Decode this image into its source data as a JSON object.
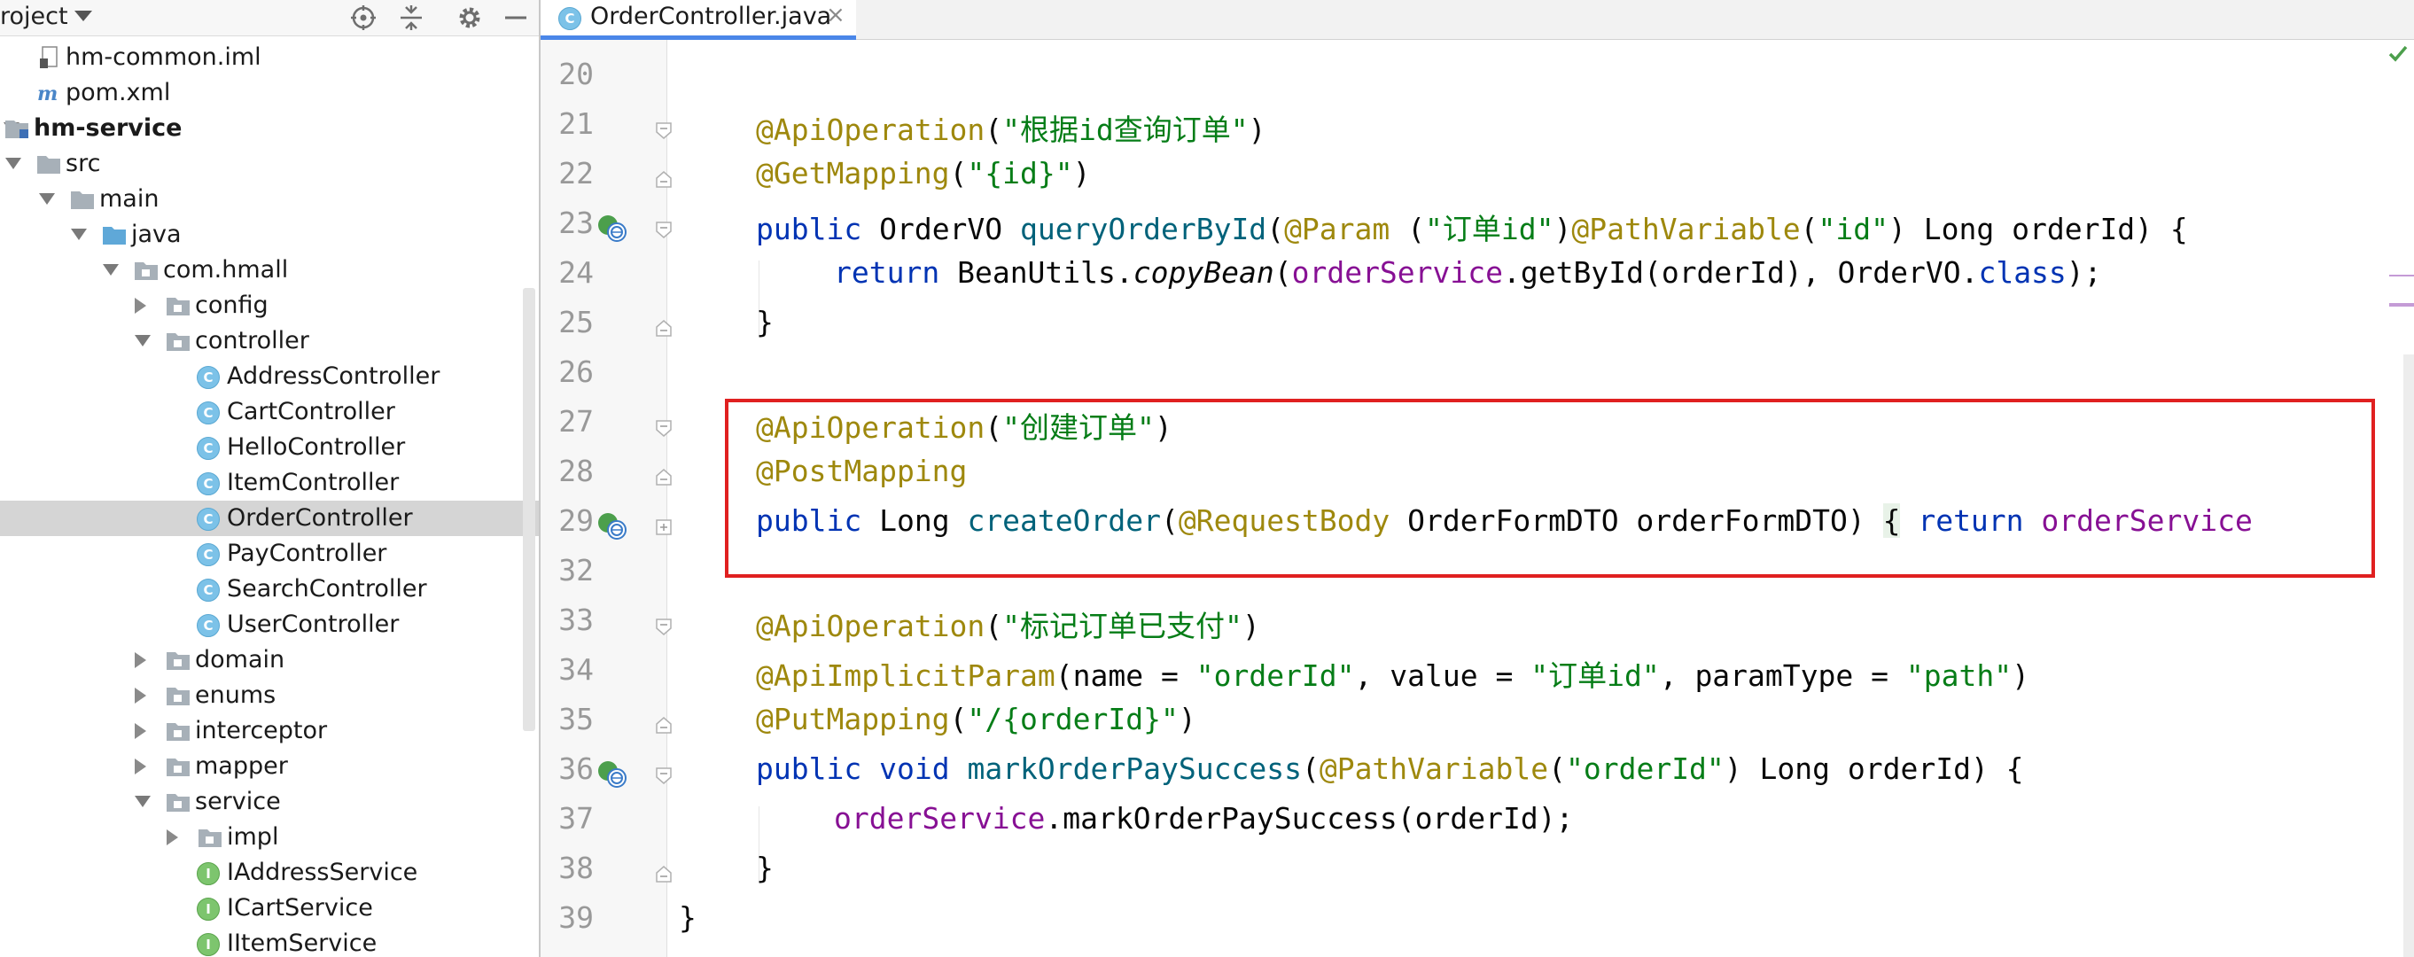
{
  "project_panel": {
    "title": "roject",
    "tree": [
      {
        "label": "hm-common.iml",
        "icon": "iml-file-icon",
        "depth": 1
      },
      {
        "label": "pom.xml",
        "icon": "maven-file-icon",
        "depth": 1
      },
      {
        "label": "hm-service",
        "icon": "module-folder-icon",
        "depth": 0,
        "bold": true
      },
      {
        "label": "src",
        "icon": "folder-icon",
        "depth": 1
      },
      {
        "label": "main",
        "icon": "folder-icon",
        "depth": 2
      },
      {
        "label": "java",
        "icon": "source-folder-icon",
        "depth": 3
      },
      {
        "label": "com.hmall",
        "icon": "package-icon",
        "depth": 4
      },
      {
        "label": "config",
        "icon": "package-icon",
        "depth": 5
      },
      {
        "label": "controller",
        "icon": "package-icon",
        "depth": 5
      },
      {
        "label": "AddressController",
        "icon": "class-icon",
        "depth": 6
      },
      {
        "label": "CartController",
        "icon": "class-icon",
        "depth": 6
      },
      {
        "label": "HelloController",
        "icon": "class-icon",
        "depth": 6
      },
      {
        "label": "ItemController",
        "icon": "class-icon",
        "depth": 6
      },
      {
        "label": "OrderController",
        "icon": "class-icon",
        "depth": 6
      },
      {
        "label": "PayController",
        "icon": "class-icon",
        "depth": 6
      },
      {
        "label": "SearchController",
        "icon": "class-icon",
        "depth": 6
      },
      {
        "label": "UserController",
        "icon": "class-icon",
        "depth": 6
      },
      {
        "label": "domain",
        "icon": "package-icon",
        "depth": 5
      },
      {
        "label": "enums",
        "icon": "package-icon",
        "depth": 5
      },
      {
        "label": "interceptor",
        "icon": "package-icon",
        "depth": 5
      },
      {
        "label": "mapper",
        "icon": "package-icon",
        "depth": 5
      },
      {
        "label": "service",
        "icon": "package-icon",
        "depth": 5
      },
      {
        "label": "impl",
        "icon": "package-icon",
        "depth": 6
      },
      {
        "label": "IAddressService",
        "icon": "interface-icon",
        "depth": 6
      },
      {
        "label": "ICartService",
        "icon": "interface-icon",
        "depth": 6
      },
      {
        "label": "IItemService",
        "icon": "interface-icon",
        "depth": 6
      }
    ],
    "class_badge": "C",
    "interface_badge": "I"
  },
  "editor": {
    "tab_label": "OrderController.java",
    "tab_close": "×",
    "line_numbers": [
      "20",
      "21",
      "22",
      "23",
      "24",
      "25",
      "26",
      "27",
      "28",
      "29",
      "32",
      "33",
      "34",
      "35",
      "36",
      "37",
      "38",
      "39"
    ],
    "lines": {
      "l21": {
        "ann": "@ApiOperation",
        "p1": "(",
        "s1": "\"根据id查询订单\"",
        "p2": ")"
      },
      "l22": {
        "ann": "@GetMapping",
        "p1": "(",
        "s1": "\"{id}\"",
        "p2": ")"
      },
      "l23": {
        "kw": "public",
        "type": " OrderVO ",
        "fn": "queryOrderById",
        "p1": "(",
        "ann1": "@Param",
        "sp": " (",
        "s1": "\"订单id\"",
        "p2": ")",
        "ann2": "@PathVariable",
        "p3": "(",
        "s2": "\"id\"",
        "p4": ") Long orderId) {"
      },
      "l24": {
        "kw": "return",
        "t1": " BeanUtils.",
        "it": "copyBean",
        "p1": "(",
        "fld": "orderService",
        "t2": ".getById(orderId), OrderVO.",
        "kw2": "class",
        "p2": ");"
      },
      "l25": {
        "t": "}"
      },
      "l27": {
        "ann": "@ApiOperation",
        "p1": "(",
        "s1": "\"创建订单\"",
        "p2": ")"
      },
      "l28": {
        "ann": "@PostMapping"
      },
      "l29": {
        "kw": "public",
        "type": " Long ",
        "fn": "createOrder",
        "p1": "(",
        "ann": "@RequestBody",
        "t1": " OrderFormDTO orderFormDTO) ",
        "fold": "{",
        "sp": " ",
        "kw2": "return",
        "sp2": " ",
        "fld": "orderService"
      },
      "l33": {
        "ann": "@ApiOperation",
        "p1": "(",
        "s1": "\"标记订单已支付\"",
        "p2": ")"
      },
      "l34": {
        "ann": "@ApiImplicitParam",
        "t1": "(name = ",
        "s1": "\"orderId\"",
        "t2": ", value = ",
        "s2": "\"订单id\"",
        "t3": ", paramType = ",
        "s3": "\"path\"",
        "p2": ")"
      },
      "l35": {
        "ann": "@PutMapping",
        "p1": "(",
        "s1": "\"/{orderId}\"",
        "p2": ")"
      },
      "l36": {
        "kw": "public",
        "sp": " ",
        "kw2": "void",
        "sp2": " ",
        "fn": "markOrderPaySuccess",
        "p1": "(",
        "ann": "@PathVariable",
        "p2": "(",
        "s1": "\"orderId\"",
        "t1": ") Long orderId) {"
      },
      "l37": {
        "fld": "orderService",
        "t1": ".markOrderPaySuccess(orderId);"
      },
      "l38": {
        "t": "}"
      },
      "l39": {
        "t": "}"
      }
    }
  },
  "colors": {
    "annotation": "#9e880d",
    "keyword": "#0033b3",
    "string": "#067d17",
    "method": "#00627a",
    "field": "#871094",
    "highlight_box": "#e02020"
  }
}
